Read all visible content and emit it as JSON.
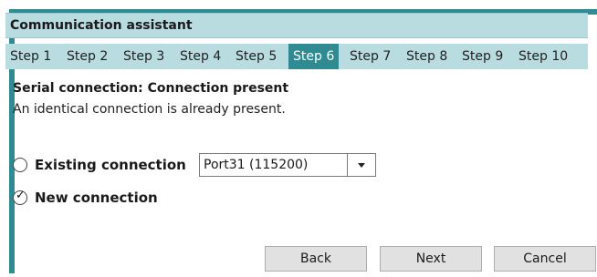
{
  "dialog": {
    "title": "Communication assistant"
  },
  "steps": [
    {
      "label": "Step 1"
    },
    {
      "label": "Step 2"
    },
    {
      "label": "Step 3"
    },
    {
      "label": "Step 4"
    },
    {
      "label": "Step 5"
    },
    {
      "label": "Step 6"
    },
    {
      "label": "Step 7"
    },
    {
      "label": "Step 8"
    },
    {
      "label": "Step 9"
    },
    {
      "label": "Step 10"
    }
  ],
  "active_step": "Step 6",
  "content": {
    "heading": "Serial connection: Connection present",
    "description": "An identical connection is already present."
  },
  "options": {
    "existing": {
      "label": "Existing connection",
      "checked": false
    },
    "new": {
      "label": "New connection",
      "checked": true
    }
  },
  "port_select": {
    "value": "Port31 (115200)"
  },
  "buttons": {
    "back": "Back",
    "next": "Next",
    "cancel": "Cancel"
  },
  "colors": {
    "accent": "#2f8b91",
    "header_bg": "#b9dce0"
  }
}
